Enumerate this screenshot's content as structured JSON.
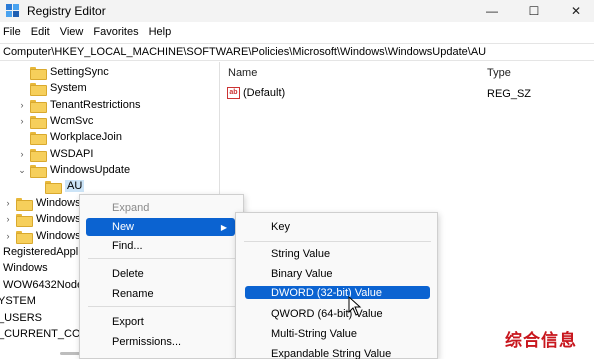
{
  "window": {
    "title": "Registry Editor",
    "buttons": {
      "minimize": "—",
      "maximize": "☐",
      "close": "✕"
    }
  },
  "menubar": [
    "File",
    "Edit",
    "View",
    "Favorites",
    "Help"
  ],
  "address": "Computer\\HKEY_LOCAL_MACHINE\\SOFTWARE\\Policies\\Microsoft\\Windows\\WindowsUpdate\\AU",
  "tree": {
    "items": [
      {
        "label": "SettingSync",
        "chevron": ""
      },
      {
        "label": "System",
        "chevron": ""
      },
      {
        "label": "TenantRestrictions",
        "chevron": "›"
      },
      {
        "label": "WcmSvc",
        "chevron": "›"
      },
      {
        "label": "WorkplaceJoin",
        "chevron": ""
      },
      {
        "label": "WSDAPI",
        "chevron": "›"
      },
      {
        "label": "WindowsUpdate",
        "chevron": "⌄"
      },
      {
        "label": "AU",
        "chevron": ""
      },
      {
        "label": "Windows",
        "chevron": "›"
      },
      {
        "label": "Windows",
        "chevron": "›"
      },
      {
        "label": "Windows",
        "chevron": "›"
      },
      {
        "label": "RegisteredAppl",
        "chevron": ""
      },
      {
        "label": "Windows",
        "chevron": ""
      },
      {
        "label": "WOW6432Node",
        "chevron": ""
      },
      {
        "label": "YSTEM",
        "chevron": ""
      },
      {
        "label": "_USERS",
        "chevron": ""
      },
      {
        "label": "_CURRENT_CON",
        "chevron": ""
      }
    ]
  },
  "list": {
    "columns": {
      "name": "Name",
      "type": "Type"
    },
    "rows": [
      {
        "icon": "ab",
        "name": "(Default)",
        "type": "REG_SZ"
      }
    ]
  },
  "context_menu": {
    "items": [
      "Expand",
      "New",
      "Find...",
      "Delete",
      "Rename",
      "Export",
      "Permissions..."
    ]
  },
  "submenu": {
    "items": [
      "Key",
      "String Value",
      "Binary Value",
      "DWORD (32-bit) Value",
      "QWORD (64-bit) Value",
      "Multi-String Value",
      "Expandable String Value"
    ]
  },
  "watermark": "综合信息",
  "colors": {
    "highlight": "#0b63d1",
    "folder": "#f6cf5b",
    "watermark": "#c8161d"
  }
}
